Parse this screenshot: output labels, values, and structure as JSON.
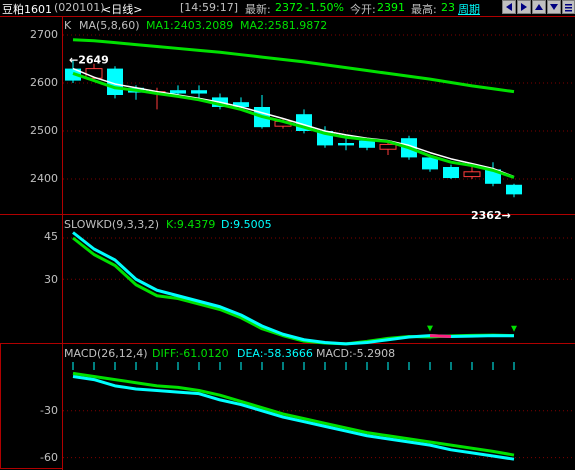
{
  "topbar": {
    "contract": "豆粕1601",
    "code": "(020101)",
    "period": "<日线>",
    "time": "[14:59:17]",
    "latest_label": "最新:",
    "latest_value": "2372",
    "change": "-1.50%",
    "open_label": "今开:",
    "open_value": "2391",
    "high_label": "最高:",
    "high_value": "23",
    "period_button": "周期"
  },
  "main_pane": {
    "label_k": "K",
    "ma_params": "MA(5,8,60)",
    "ma1": "MA1:2403.2089",
    "ma2": "MA2:2581.9872",
    "y_ticks": [
      "2700",
      "2600",
      "2500",
      "2400"
    ],
    "high_marker": "2649",
    "low_marker": "2362"
  },
  "kd_pane": {
    "label": "SLOWKD(9,3,3,2)",
    "k": "K:9.4379",
    "d": "D:9.5005",
    "y_ticks": [
      "45",
      "30"
    ]
  },
  "macd_pane": {
    "label": "MACD(26,12,4)",
    "diff": "DIFF:-61.0120",
    "dea": "DEA:-58.3666",
    "macd": "MACD:-5.2908",
    "y_ticks": [
      "-30",
      "-60"
    ]
  },
  "colors": {
    "rise": "#ff3c3c",
    "fall": "#00ffff",
    "ma_green": "#00e000",
    "label_yellow": "#ffff00",
    "border_red": "#b00000"
  },
  "chart_data": {
    "type": "candlestick",
    "candles": [
      {
        "o": 2630,
        "h": 2649,
        "c": 2605,
        "l": 2600
      },
      {
        "o": 2610,
        "h": 2640,
        "c": 2630,
        "l": 2605
      },
      {
        "o": 2630,
        "h": 2635,
        "c": 2575,
        "l": 2568
      },
      {
        "o": 2590,
        "h": 2595,
        "c": 2580,
        "l": 2565
      },
      {
        "o": 2580,
        "h": 2590,
        "c": 2582,
        "l": 2545
      },
      {
        "o": 2585,
        "h": 2595,
        "c": 2578,
        "l": 2570
      },
      {
        "o": 2585,
        "h": 2595,
        "c": 2578,
        "l": 2565
      },
      {
        "o": 2570,
        "h": 2578,
        "c": 2550,
        "l": 2545
      },
      {
        "o": 2560,
        "h": 2570,
        "c": 2550,
        "l": 2545
      },
      {
        "o": 2550,
        "h": 2575,
        "c": 2508,
        "l": 2505
      },
      {
        "o": 2510,
        "h": 2525,
        "c": 2520,
        "l": 2505
      },
      {
        "o": 2535,
        "h": 2545,
        "c": 2500,
        "l": 2495
      },
      {
        "o": 2500,
        "h": 2510,
        "c": 2470,
        "l": 2465
      },
      {
        "o": 2475,
        "h": 2490,
        "c": 2470,
        "l": 2460
      },
      {
        "o": 2480,
        "h": 2485,
        "c": 2465,
        "l": 2460
      },
      {
        "o": 2462,
        "h": 2475,
        "c": 2472,
        "l": 2450
      },
      {
        "o": 2485,
        "h": 2490,
        "c": 2445,
        "l": 2440
      },
      {
        "o": 2445,
        "h": 2450,
        "c": 2420,
        "l": 2415
      },
      {
        "o": 2425,
        "h": 2430,
        "c": 2402,
        "l": 2400
      },
      {
        "o": 2405,
        "h": 2425,
        "c": 2415,
        "l": 2400
      },
      {
        "o": 2420,
        "h": 2435,
        "c": 2390,
        "l": 2385
      },
      {
        "o": 2388,
        "h": 2390,
        "c": 2368,
        "l": 2362
      }
    ],
    "ma_short": [
      2620,
      2605,
      2590,
      2585,
      2578,
      2572,
      2565,
      2555,
      2545,
      2530,
      2520,
      2508,
      2495,
      2487,
      2482,
      2478,
      2465,
      2448,
      2435,
      2428,
      2418,
      2403.2089
    ],
    "ma_mid": [
      2630,
      2612,
      2598,
      2590,
      2582,
      2575,
      2568,
      2560,
      2550,
      2538,
      2526,
      2513,
      2500,
      2492,
      2485,
      2480,
      2470,
      2455,
      2442,
      2432,
      2422,
      2405
    ],
    "ma_long": [
      2690,
      2688,
      2684,
      2680,
      2676,
      2672,
      2668,
      2664,
      2659,
      2654,
      2649,
      2644,
      2638,
      2632,
      2626,
      2620,
      2614,
      2608,
      2601,
      2594,
      2588,
      2581.9872
    ],
    "kd_k": [
      47,
      41,
      37,
      30,
      26,
      24,
      22,
      20,
      17,
      13,
      10,
      8,
      7,
      6.5,
      7,
      8,
      9,
      9.5,
      9.2,
      9.3,
      9.5,
      9.4379
    ],
    "kd_d": [
      45,
      39,
      35,
      28,
      24,
      23,
      21,
      19,
      16,
      12,
      9.5,
      7.5,
      6.8,
      6.5,
      7.4,
      8.5,
      9.2,
      9.0,
      9.4,
      9.6,
      9.7,
      9.5005
    ],
    "macd_diff": [
      -8,
      -10,
      -14,
      -16,
      -17,
      -18,
      -19,
      -23,
      -26,
      -30,
      -34,
      -37,
      -40,
      -43,
      -46,
      -48,
      -50,
      -52,
      -55,
      -57,
      -59,
      -61.012
    ],
    "macd_dea": [
      -6,
      -8,
      -10,
      -12,
      -14,
      -15,
      -17,
      -20,
      -24,
      -28,
      -32,
      -35,
      -38,
      -41,
      -44,
      -46,
      -48,
      -50,
      -52,
      -54,
      -56,
      -58.3666
    ]
  }
}
